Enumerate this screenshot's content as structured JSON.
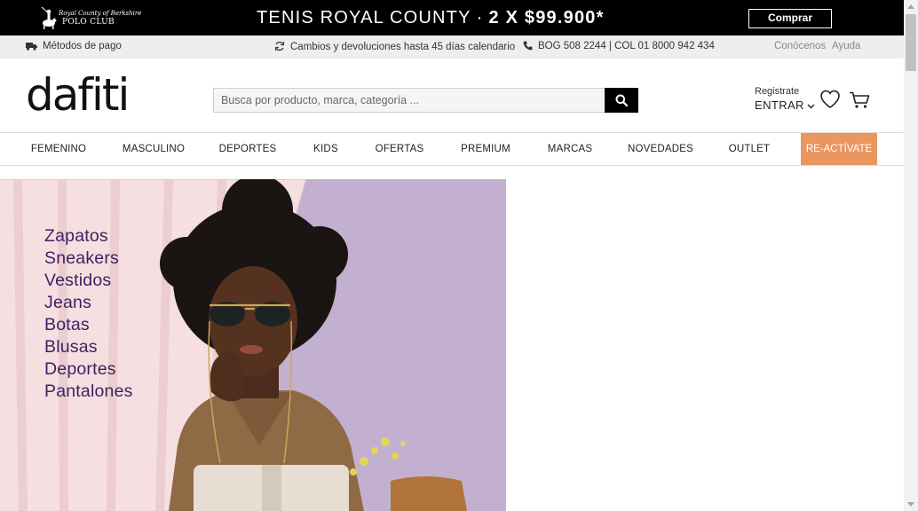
{
  "promo": {
    "brand_line1": "Royal County of Berkshire",
    "brand_line2": "POLO CLUB",
    "headline": "TENIS ROYAL COUNTY",
    "separator": "·",
    "offer": "2 X $99.900*",
    "button_label": "Comprar",
    "colors": {
      "background": "#000000",
      "text": "#ffffff"
    }
  },
  "utility": {
    "payment": "Métodos de pago",
    "returns": "Cambios y devoluciones hasta 45 días calendario",
    "phones": "BOG 508 2244 | COL 01 8000 942 434",
    "about": "Conócenos",
    "help": "Ayuda",
    "icons": {
      "payment": "truck-icon",
      "returns": "refresh-icon",
      "phone": "phone-icon"
    }
  },
  "header": {
    "logo": "dafiti",
    "search_placeholder": "Busca por producto, marca, categoría ...",
    "search_icon": "search-icon",
    "register": "Registrate",
    "login": "ENTRAR",
    "wishlist_icon": "heart-icon",
    "cart_icon": "cart-icon"
  },
  "nav": {
    "items": [
      "FEMENINO",
      "MASCULINO",
      "DEPORTES",
      "KIDS",
      "OFERTAS",
      "PREMIUM",
      "MARCAS",
      "NOVEDADES",
      "OUTLET"
    ],
    "highlight": "RE-ACTÍVATE",
    "highlight_color": "#e9965f"
  },
  "banner": {
    "categories": [
      "Zapatos",
      "Sneakers",
      "Vestidos",
      "Jeans",
      "Botas",
      "Blusas",
      "Deportes",
      "Pantalones"
    ],
    "text_color": "#3e2163",
    "background": "#c2b0cf"
  }
}
